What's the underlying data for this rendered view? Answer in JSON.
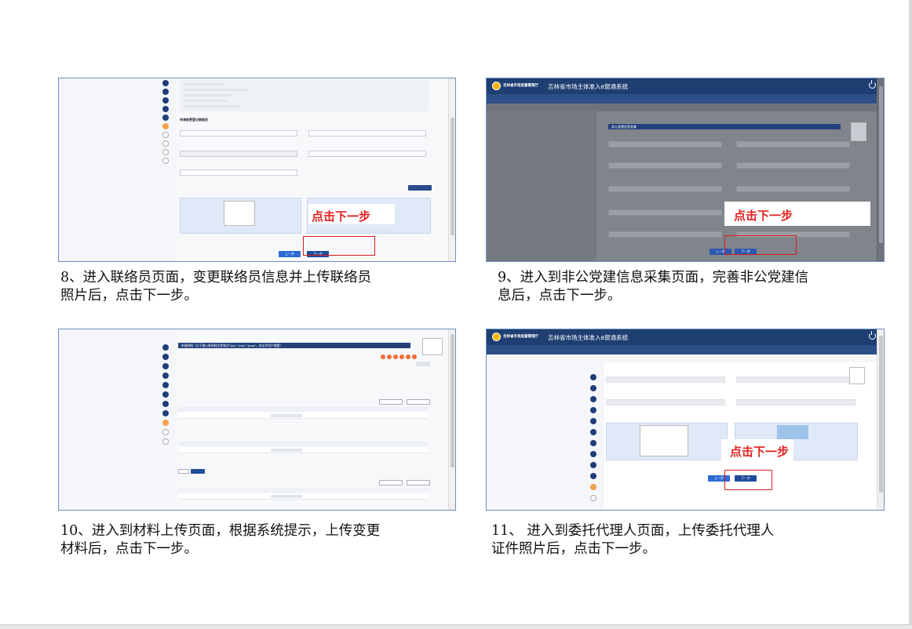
{
  "captions": {
    "step8_line1": "8、进入联络员页面，变更联络员信息并上传联络员",
    "step8_line2": "照片后，点击下一步。",
    "step9_line1": "9、进入到非公党建信息采集页面，完善非公党建信",
    "step9_line2": "息后，点击下一步。",
    "step10_line1": "10、进入到材料上传页面，根据系统提示，上传变更",
    "step10_line2": "材料后，点击下一步。",
    "step11_line1": "11、 进入到委托代理人页面，上传委托代理人",
    "step11_line2": "证件照片后，点击下一步。"
  },
  "hints": {
    "click_next": "点击下一步"
  },
  "app": {
    "system_title": "吉林省市场主体准入e窗通系统",
    "department": "吉林省市场监督管理厅"
  },
  "screens": {
    "liaison": {
      "section_title": "申请变更登记联络员",
      "prev_button": "上一步",
      "next_button": "下一步"
    },
    "party": {
      "section_title": "非公党建信息采集",
      "prev_button": "上一步",
      "next_button": "下一步"
    },
    "materials": {
      "section_title": "申请材料（以下输入框材料文件格式\"jpg\",\"png\",\"jpeg\"，仅允许用户查看）"
    },
    "agent": {
      "prev_button": "上一步",
      "next_button": "下一步"
    }
  },
  "colors": {
    "hint_red": "#e02020",
    "primary_blue": "#2d6bd6",
    "nav_dark": "#1f3f73",
    "active_step": "#f3a14a"
  }
}
